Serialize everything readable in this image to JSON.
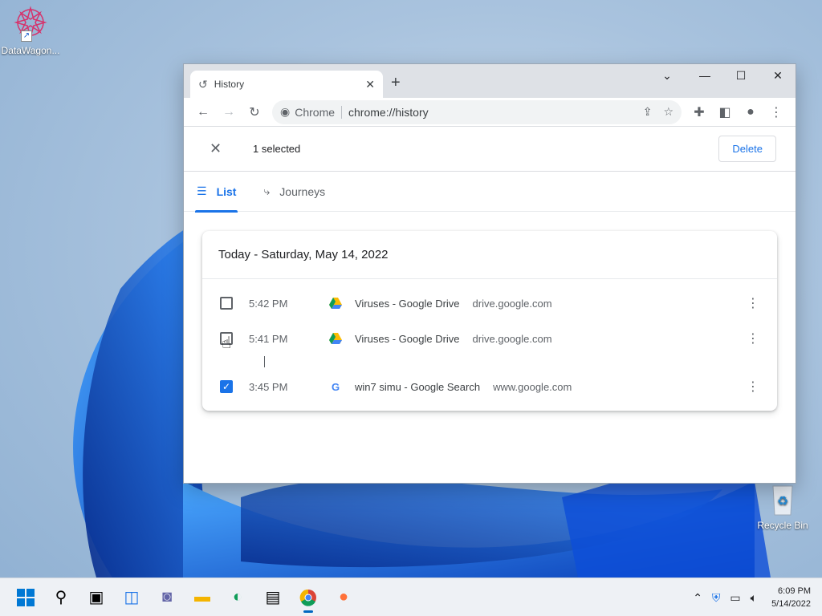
{
  "desktop": {
    "icons": [
      {
        "label": "DataWagon...",
        "icon": "datawagon-app-icon"
      },
      {
        "label": "Recycle Bin",
        "icon": "recycle-bin-icon"
      }
    ]
  },
  "browser": {
    "tab": {
      "title": "History",
      "icon": "history-icon"
    },
    "window_controls": [
      "chevron-down-icon",
      "minimize-icon",
      "maximize-icon",
      "close-icon"
    ],
    "omnibox": {
      "origin": "Chrome",
      "url": "chrome://history"
    }
  },
  "history": {
    "selection": {
      "count_label": "1 selected",
      "delete_label": "Delete"
    },
    "tabs": [
      {
        "label": "List",
        "active": true
      },
      {
        "label": "Journeys",
        "active": false
      }
    ],
    "day_header": "Today - Saturday, May 14, 2022",
    "entries": [
      {
        "time": "5:42 PM",
        "title": "Viruses - Google Drive",
        "domain": "drive.google.com",
        "favicon": "google-drive-icon",
        "checked": false
      },
      {
        "time": "5:41 PM",
        "title": "Viruses - Google Drive",
        "domain": "drive.google.com",
        "favicon": "google-drive-icon",
        "checked": false
      },
      {
        "time": "3:45 PM",
        "title": "win7 simu - Google Search",
        "domain": "www.google.com",
        "favicon": "google-g-icon",
        "checked": true
      }
    ]
  },
  "taskbar": {
    "apps": [
      "start-icon",
      "search-icon",
      "task-view-icon",
      "widgets-icon",
      "chat-icon",
      "file-explorer-icon",
      "edge-icon",
      "store-icon",
      "chrome-icon",
      "firefox-icon"
    ],
    "clock": {
      "time": "6:09 PM",
      "date": "5/14/2022"
    }
  },
  "colors": {
    "accent": "#1a73e8",
    "taskbar": "#eef1f5",
    "titlebar": "#dee1e6"
  }
}
